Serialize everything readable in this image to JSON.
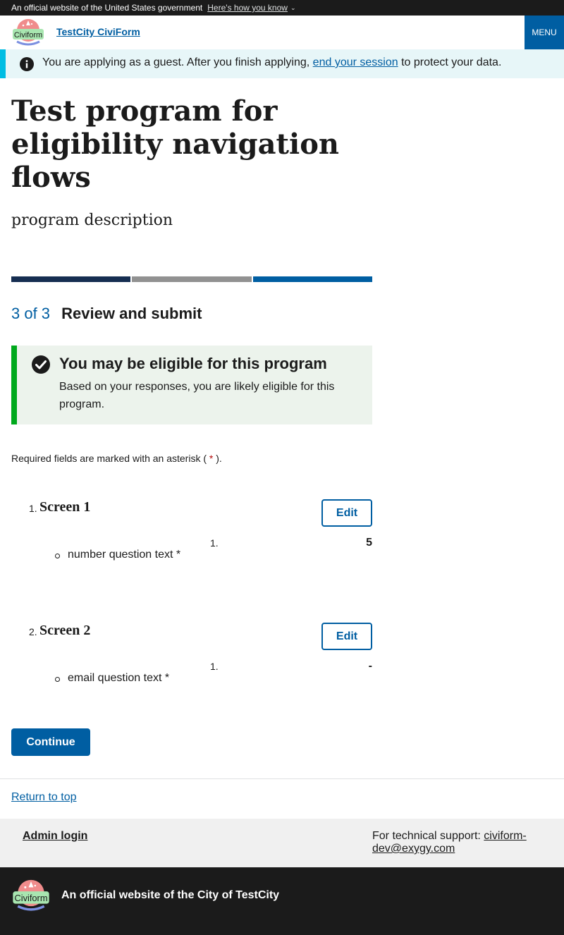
{
  "gov_banner": {
    "text": "An official website of the United States government",
    "link": "Here's how you know"
  },
  "header": {
    "logo_text": "Civiform",
    "site_title": "TestCity CiviForm",
    "menu_label": "MENU"
  },
  "guest_alert": {
    "text_before": "You are applying as a guest. After you finish applying, ",
    "link": "end your session",
    "text_after": " to protect your data."
  },
  "program": {
    "title": "Test program for eligibility navigation flows",
    "description": "program description"
  },
  "progress": {
    "step_count": "3 of 3",
    "step_name": "Review and submit",
    "colors": [
      "#162e51",
      "#919191",
      "#005ea2"
    ]
  },
  "eligibility": {
    "title": "You may be eligible for this program",
    "body": "Based on your responses, you are likely eligible for this program."
  },
  "required_note": {
    "before": "Required fields are marked with an asterisk ( ",
    "asterisk": "*",
    "after": " )."
  },
  "screens": [
    {
      "number": "1.",
      "title": "Screen 1",
      "edit_label": "Edit",
      "question": "number question text *",
      "answer_number": "1.",
      "answer": "5"
    },
    {
      "number": "2.",
      "title": "Screen 2",
      "edit_label": "Edit",
      "question": "email question text *",
      "answer_number": "1.",
      "answer": "-"
    }
  ],
  "continue_label": "Continue",
  "return_to_top": "Return to top",
  "footer": {
    "admin_login": "Admin login",
    "support_label": "For technical support: ",
    "support_email": "civiform-dev@exygy.com",
    "official_text": "An official website of the City of TestCity",
    "logo_text": "Civiform"
  }
}
